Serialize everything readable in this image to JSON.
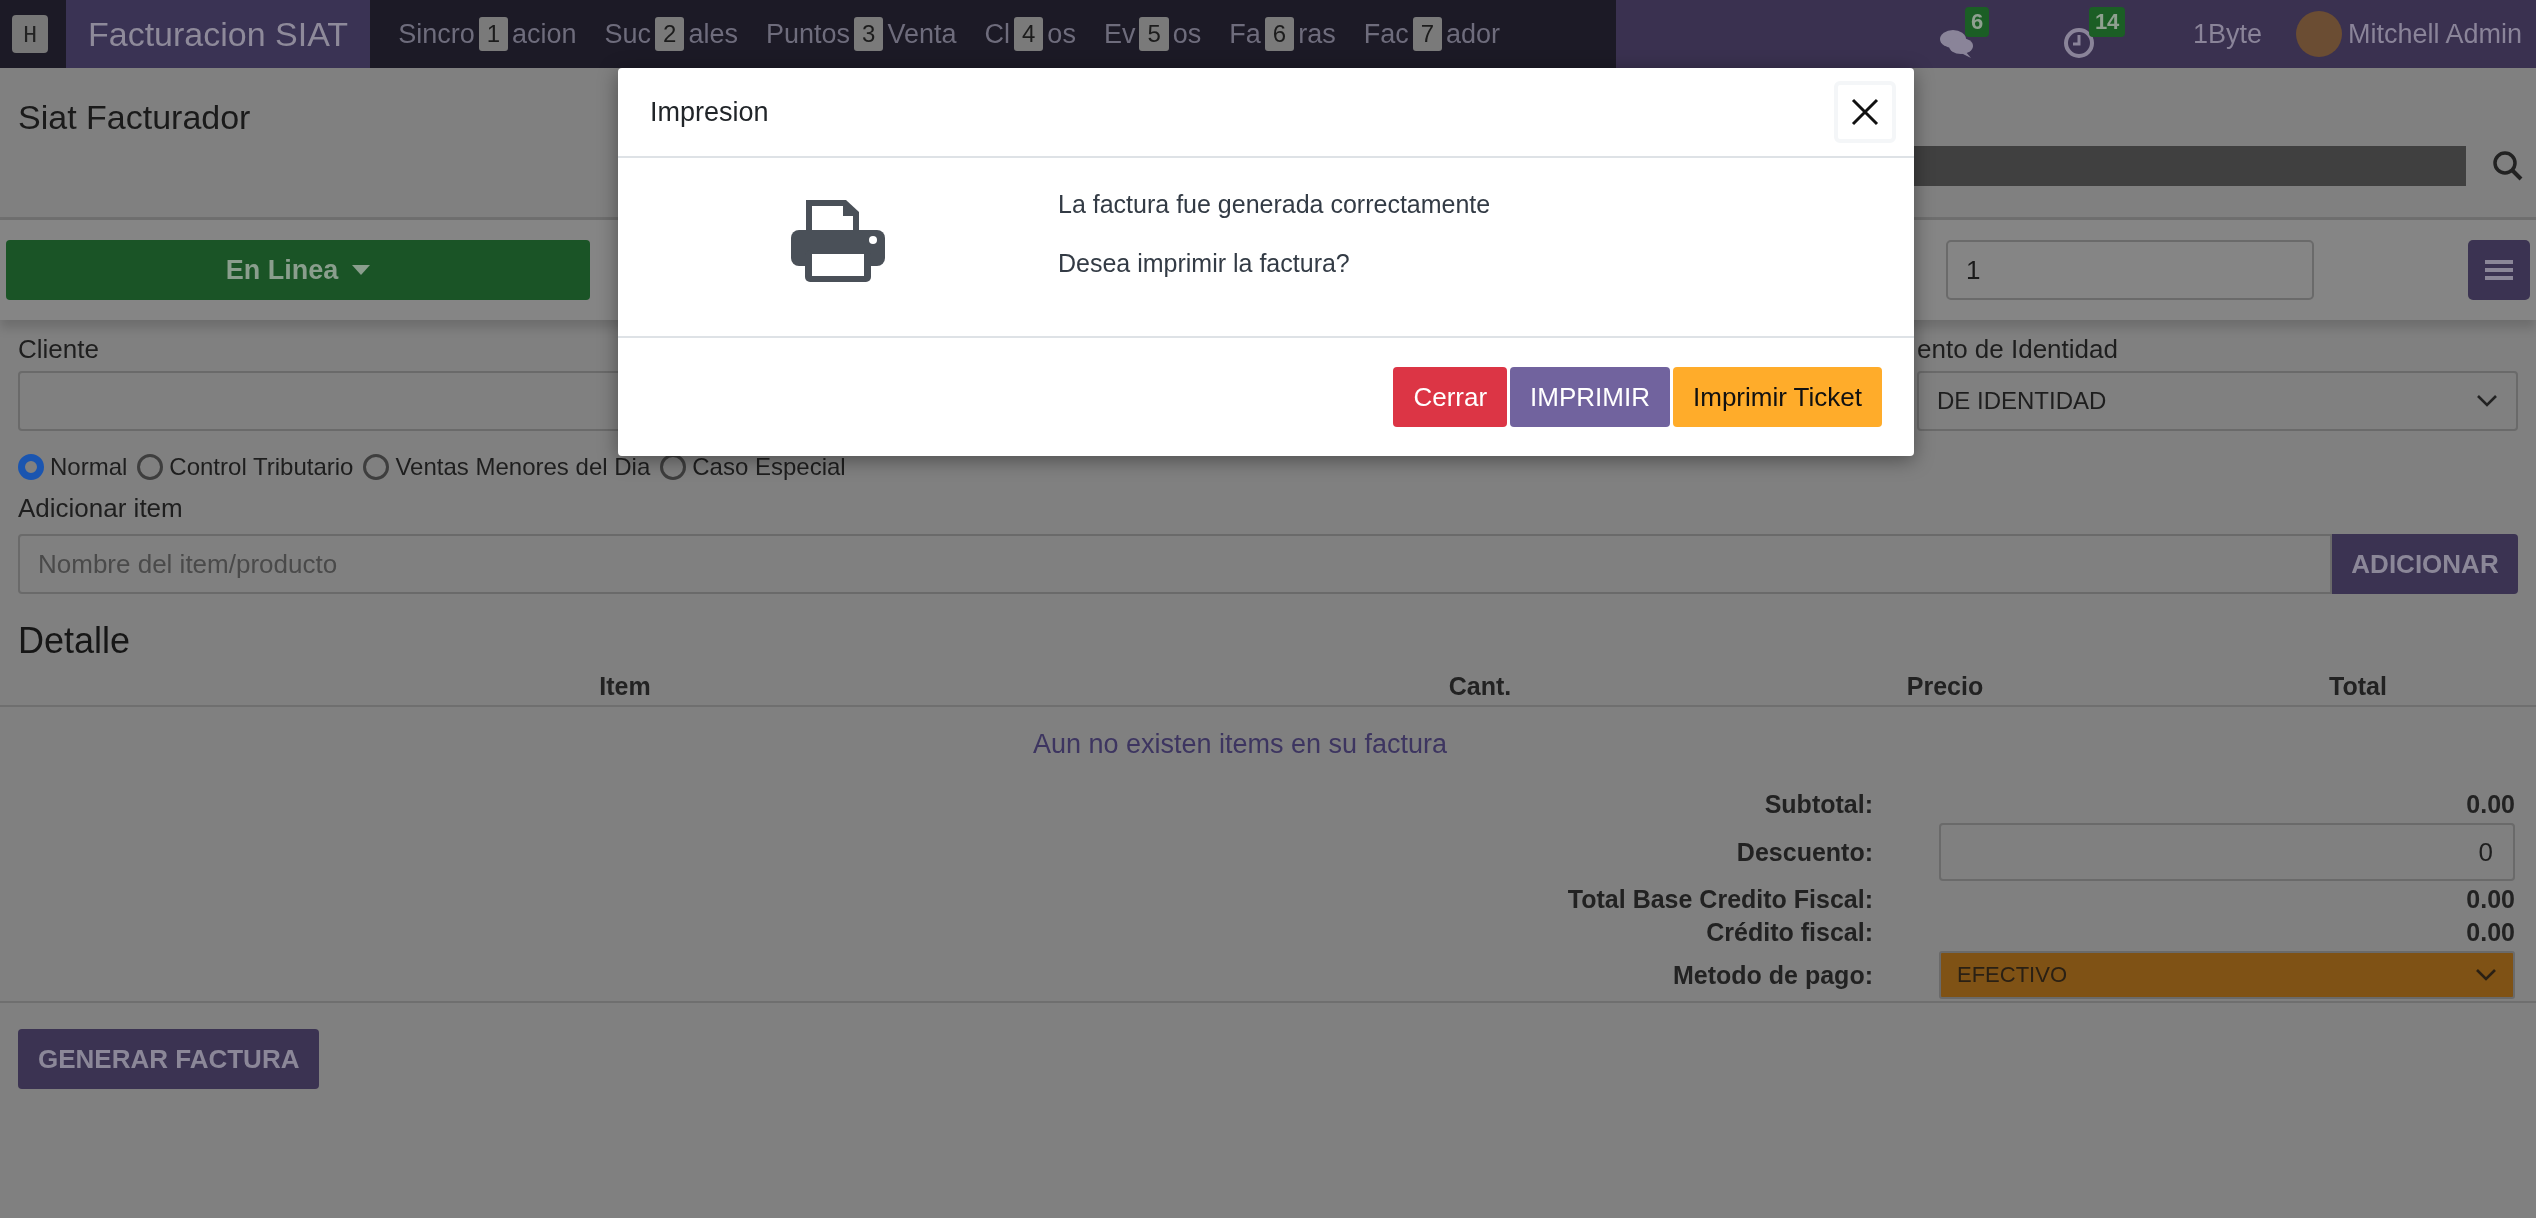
{
  "navbar": {
    "app_key": "H",
    "app_name": "Facturacion SIAT",
    "menus": [
      {
        "before": "Sincro",
        "key": "1",
        "after": "acion"
      },
      {
        "before": "Suc",
        "key": "2",
        "after": "ales"
      },
      {
        "before": "Puntos",
        "key": "3",
        "after": "Venta"
      },
      {
        "before": "Cl",
        "key": "4",
        "after": "os"
      },
      {
        "before": "Ev",
        "key": "5",
        "after": "os"
      },
      {
        "before": "Fa",
        "key": "6",
        "after": "ras"
      },
      {
        "before": "Fac",
        "key": "7",
        "after": "ador"
      }
    ],
    "chat_count": "6",
    "activity_count": "14",
    "company": "1Byte",
    "user": "Mitchell Admin"
  },
  "page": {
    "title": "Siat Facturador",
    "mode_button": "En Linea",
    "quantity": "1"
  },
  "form": {
    "client_label": "Cliente",
    "document_label": "ento de Identidad",
    "document_value": "DE IDENTIDAD",
    "sale_types": [
      {
        "label": "Normal",
        "selected": true
      },
      {
        "label": "Control Tributario",
        "selected": false
      },
      {
        "label": "Ventas Menores del Dia",
        "selected": false
      },
      {
        "label": "Caso Especial",
        "selected": false
      }
    ],
    "item_label": "Adicionar item",
    "item_placeholder": "Nombre del item/producto",
    "add_button": "ADICIONAR"
  },
  "detail": {
    "title": "Detalle",
    "columns": [
      "Item",
      "Cant.",
      "Precio",
      "Total"
    ],
    "empty_message": "Aun no existen items en su factura"
  },
  "totals": [
    {
      "kind": "text",
      "label": "Subtotal:",
      "value": "0.00"
    },
    {
      "kind": "input",
      "label": "Descuento:",
      "value": "0"
    },
    {
      "kind": "text",
      "label": "Total Base Credito Fiscal:",
      "value": "0.00"
    },
    {
      "kind": "text",
      "label": "Crédito fiscal:",
      "value": "0.00"
    },
    {
      "kind": "select",
      "label": "Metodo de pago:",
      "value": "EFECTIVO"
    }
  ],
  "generate_button": "GENERAR FACTURA",
  "modal": {
    "title": "Impresion",
    "messages": [
      "La factura fue generada correctamente",
      "Desea imprimir la factura?"
    ],
    "buttons": [
      {
        "label": "Cerrar",
        "kind": "danger"
      },
      {
        "label": "IMPRIMIR",
        "kind": "primary"
      },
      {
        "label": "Imprimir Ticket",
        "kind": "warning"
      }
    ]
  }
}
